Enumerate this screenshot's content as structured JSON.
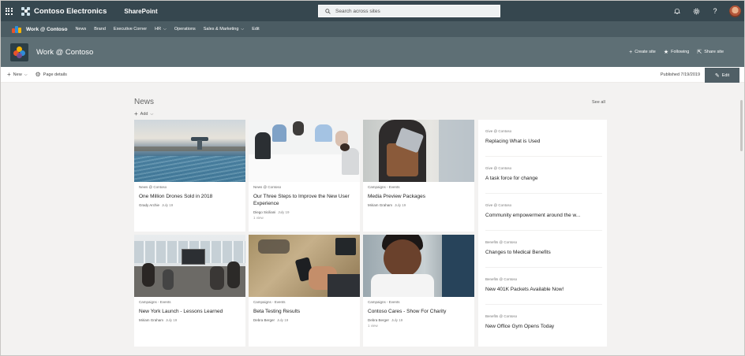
{
  "suite": {
    "org_name": "Contoso Electronics",
    "app_name": "SharePoint",
    "search_placeholder": "Search across sites",
    "icons": [
      "bell-icon",
      "gear-icon",
      "help-icon"
    ]
  },
  "hub": {
    "title": "Work @ Contoso",
    "items": [
      {
        "label": "News"
      },
      {
        "label": "Brand"
      },
      {
        "label": "Executive Corner"
      },
      {
        "label": "HR",
        "dropdown": true
      },
      {
        "label": "Operations"
      },
      {
        "label": "Sales & Marketing",
        "dropdown": true
      },
      {
        "label": "Edit"
      }
    ]
  },
  "site": {
    "title": "Work @ Contoso",
    "actions": [
      {
        "icon": "plus-icon",
        "label": "Create site"
      },
      {
        "icon": "star-icon",
        "label": "Following"
      },
      {
        "icon": "share-icon",
        "label": "Share site"
      }
    ]
  },
  "command_bar": {
    "new_label": "New",
    "page_details_label": "Page details",
    "published": "Published 7/19/2019",
    "edit_label": "Edit"
  },
  "news": {
    "title": "News",
    "see_all": "See all",
    "add_label": "Add",
    "cards": [
      {
        "category": "News @ Contoso",
        "title": "One Million Drones Sold in 2018",
        "author": "Grady Archie",
        "date": "July 19",
        "views": ""
      },
      {
        "category": "News @ Contoso",
        "title": "Our Three Steps to Improve the New User Experience",
        "author": "Diego Siciliani",
        "date": "July 19",
        "views": "1 view"
      },
      {
        "category": "Campaigns - Events",
        "title": "Media Preview Packages",
        "author": "Miriam Graham",
        "date": "July 19",
        "views": ""
      },
      {
        "category": "Campaigns - Events",
        "title": "New York Launch - Lessons Learned",
        "author": "Miriam Graham",
        "date": "July 19",
        "views": ""
      },
      {
        "category": "Campaigns - Events",
        "title": "Beta Testing Results",
        "author": "Debra Berger",
        "date": "July 19",
        "views": ""
      },
      {
        "category": "Campaigns - Events",
        "title": "Contoso Cares - Show For Charity",
        "author": "Debra Berger",
        "date": "July 19",
        "views": "1 view"
      }
    ],
    "side": [
      {
        "category": "Give @ Contoso",
        "title": "Replacing What is Used"
      },
      {
        "category": "Give @ Contoso",
        "title": "A task force for change"
      },
      {
        "category": "Give @ Contoso",
        "title": "Community empowerment around the w..."
      },
      {
        "category": "Benefits @ Contoso",
        "title": "Changes to Medical Benefits"
      },
      {
        "category": "Benefits @ Contoso",
        "title": "New 401K Packets Available Now!"
      },
      {
        "category": "Benefits @ Contoso",
        "title": "New Office Gym Opens Today"
      }
    ]
  },
  "colors": {
    "suitebar": "#36474f",
    "hubnav": "#4b5c63",
    "site_header": "#5e6f75",
    "edit_button": "#505f66"
  }
}
